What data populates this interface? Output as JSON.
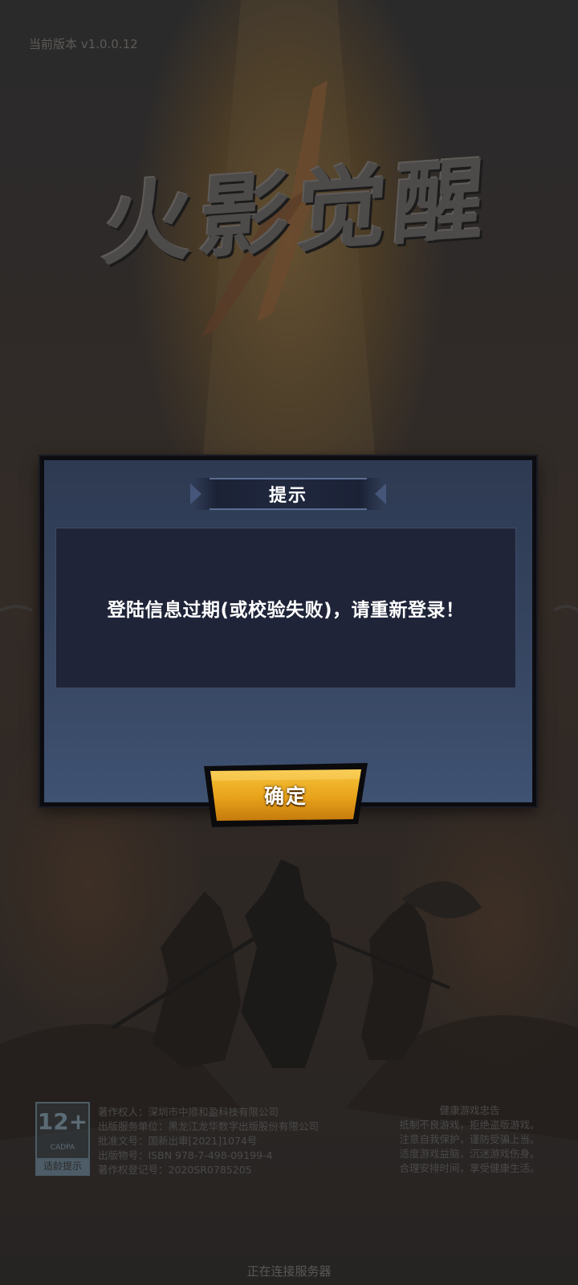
{
  "version_text": "当前版本 v1.0.0.12",
  "logo_text": "火影觉醒",
  "dialog": {
    "title": "提示",
    "message": "登陆信息过期(或校验失败)，请重新登录！",
    "confirm_label": "确定"
  },
  "age_rating": {
    "number": "12+",
    "org": "CADPA",
    "tip": "适龄提示"
  },
  "publication_info": [
    "著作权人：深圳市中顺和盈科技有限公司",
    "出版服务单位：黑龙江龙华数字出版股份有限公司",
    "批准文号：国新出审[2021]1074号",
    "出版物号：ISBN 978-7-498-09199-4",
    "著作权登记号：2020SR0785205"
  ],
  "health_notice": {
    "title": "健康游戏忠告",
    "lines": [
      "抵制不良游戏，拒绝盗版游戏。",
      "注意自我保护，谨防受骗上当。",
      "适度游戏益脑，沉迷游戏伤身。",
      "合理安排时间，享受健康生活。"
    ]
  },
  "status_text": "正在连接服务器",
  "colors": {
    "dialog_bg": "#364560",
    "message_bg": "#1f2438",
    "button_gold": "#e8a21a"
  }
}
